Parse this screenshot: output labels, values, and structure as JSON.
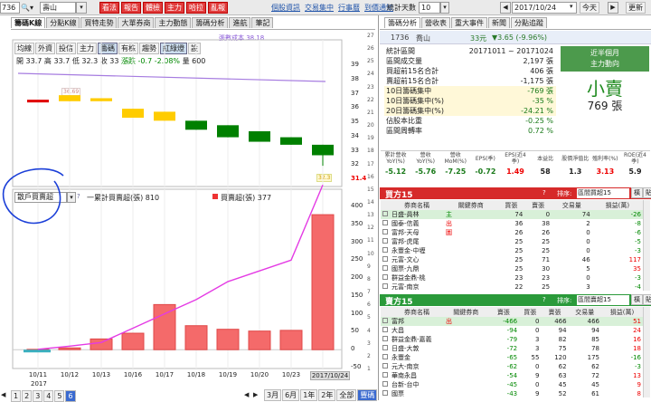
{
  "topbar": {
    "stock_code": "736",
    "stock_name": "壽山",
    "buttons": [
      "看法",
      "報告",
      "體檢",
      "主力",
      "哈拉",
      "亂報"
    ],
    "links": [
      "個股資訊",
      "交易集中",
      "行事曆",
      "到價通知"
    ],
    "right_label": "統計天數",
    "days": "10",
    "date": "2017/10/24",
    "today_btn": "今天",
    "update_btn": "更新"
  },
  "left_tabs": [
    "籌碼K線",
    "分點K線",
    "買特走勢",
    "大單券商",
    "主力動態",
    "籌碼分析",
    "進航",
    "筆記"
  ],
  "chart": {
    "tool_buttons": [
      "均線",
      "外資",
      "投信",
      "主力",
      "籌碼",
      "有株",
      "趨勢",
      "紅綠燈",
      "設"
    ],
    "ohlc": {
      "open_label": "開",
      "open": "33.7",
      "high_label": "高",
      "high": "33.7",
      "low_label": "低",
      "low": "32.3",
      "close_label": "收",
      "close": "33",
      "change_label": "漲跌",
      "change": "-0.7",
      "pct": "-2.08%",
      "vol_label": "量",
      "vol": "600"
    },
    "cost_label": "張數成本 38.18",
    "price_note": "36.69",
    "last_price_tag": "32.3",
    "price_axis": [
      "39",
      "38",
      "37",
      "36",
      "35",
      "34",
      "33",
      "32",
      "31.4"
    ],
    "vol_axis": [
      "27",
      "26",
      "25",
      "24",
      "23",
      "22",
      "21",
      "20",
      "19",
      "18",
      "17",
      "16",
      "15",
      "14",
      "13",
      "12",
      "11",
      "10",
      "9",
      "8",
      "7",
      "6",
      "5",
      "4",
      "3",
      "2",
      "1"
    ],
    "left_axis": [
      "400",
      "350",
      "300",
      "250",
      "200",
      "150",
      "100",
      "50",
      "0",
      "-50"
    ],
    "select_label": "散戶買賣超",
    "legend1": "一累計買賣超(張) 810",
    "legend2": "買賣超(張) 377",
    "dates": [
      "10/11",
      "10/12",
      "10/13",
      "10/16",
      "10/17",
      "10/18",
      "10/19",
      "10/20",
      "10/23",
      "2017/10/24"
    ],
    "year": "2017",
    "bottom_tabs": [
      "1",
      "2",
      "3",
      "4",
      "5",
      "6"
    ],
    "period_buttons": [
      "3月",
      "6月",
      "1年",
      "2年",
      "全部",
      "豐碼"
    ]
  },
  "chart_data": {
    "type": "bar",
    "categories": [
      "10/11",
      "10/12",
      "10/13",
      "10/16",
      "10/17",
      "10/18",
      "10/19",
      "10/20",
      "10/23",
      "10/24"
    ],
    "candles": [
      {
        "open": 36.7,
        "close": 36.7,
        "high": 36.7,
        "low": 36.7
      },
      {
        "open": 37.0,
        "close": 36.6,
        "high": 37.0,
        "low": 36.6
      },
      {
        "open": 36.6,
        "close": 36.8,
        "high": 36.8,
        "low": 36.6
      },
      {
        "open": 36.1,
        "close": 35.5,
        "high": 36.1,
        "low": 35.5
      },
      {
        "open": 35.9,
        "close": 35.3,
        "high": 35.9,
        "low": 35.3
      },
      {
        "open": 35.3,
        "close": 34.7,
        "high": 35.3,
        "low": 34.7
      },
      {
        "open": 35.0,
        "close": 34.2,
        "high": 35.0,
        "low": 34.2
      },
      {
        "open": 34.6,
        "close": 33.9,
        "high": 34.6,
        "low": 33.9
      },
      {
        "open": 34.2,
        "close": 33.7,
        "high": 34.2,
        "low": 33.7
      },
      {
        "open": 33.7,
        "close": 33.0,
        "high": 33.7,
        "low": 32.3
      }
    ],
    "candle_colors": [
      "#e00000",
      "#ffcc00",
      "#ffcc00",
      "#ffcc00",
      "#ffcc00",
      "#008000",
      "#008000",
      "#008000",
      "#008000",
      "#008000"
    ],
    "series": [
      {
        "name": "買賣超(張)",
        "values": [
          1,
          5,
          30,
          46,
          126,
          67,
          57,
          52,
          54,
          377
        ]
      },
      {
        "name": "累計買賣超(張)",
        "values": [
          1,
          10,
          20,
          60,
          100,
          140,
          190,
          220,
          250,
          810
        ]
      }
    ],
    "ylim": [
      -50,
      400
    ]
  },
  "right_tabs": [
    "籌碼分析",
    "營收表",
    "重大事件",
    "新聞",
    "分點追蹤"
  ],
  "summary": {
    "code": "1736",
    "name": "喬山",
    "price": "33元",
    "change": "▼3.65 (-9.96%)",
    "rows": [
      {
        "label": "統計區間",
        "value": "20171011 ~ 20171024"
      },
      {
        "label": "區間成交量",
        "value": "2,197 張"
      },
      {
        "label": "買超前15名合計",
        "value": "406 張"
      },
      {
        "label": "賣超前15名合計",
        "value": "-1,175 張"
      },
      {
        "label": "10日籌碼集中",
        "value": "-769 張"
      },
      {
        "label": "10日籌碼集中(%)",
        "value": "-35 %"
      },
      {
        "label": "20日籌碼集中(%)",
        "value": "-24.21 %"
      },
      {
        "label": "佔股本比重",
        "value": "-0.25 %"
      },
      {
        "label": "區間周轉率",
        "value": "0.72 %"
      }
    ],
    "side_title1": "近半個月",
    "side_title2": "主力動向",
    "verdict": "小賣",
    "verdict_value": "769 張"
  },
  "metrics": {
    "headers": [
      "累計營收YoY(%)",
      "營收YoY(%)",
      "營收MoM(%)",
      "EPS(季)",
      "EPS(近4季)",
      "本益比",
      "股價淨值比",
      "殖利率(%)",
      "ROE(近4季)"
    ],
    "values": [
      "-5.12",
      "-5.76",
      "-7.25",
      "-0.72",
      "1.49",
      "58",
      "1.3",
      "3.13",
      "5.9"
    ]
  },
  "buy15": {
    "title": "買方15",
    "sort_label": "排序:",
    "sort_value": "區間買超15",
    "btn1": "橫",
    "btn2": "貼",
    "headers": [
      "券商名稱",
      "關鍵券商",
      "買張",
      "賣張",
      "交易量",
      "損益(萬)"
    ],
    "rows": [
      {
        "name": "日盛-員林",
        "key": "主",
        "buy": "74",
        "sell": "0",
        "vol": "74",
        "pl": "-26"
      },
      {
        "name": "國泰-信義",
        "key": "出",
        "buy": "36",
        "sell": "38",
        "vol": "2",
        "pl": "-8"
      },
      {
        "name": "富邦-天母",
        "key": "圖",
        "buy": "26",
        "sell": "26",
        "vol": "0",
        "pl": "-6"
      },
      {
        "name": "富邦-虎尾",
        "key": "",
        "buy": "25",
        "sell": "25",
        "vol": "0",
        "pl": "-5"
      },
      {
        "name": "永豐金-中壢",
        "key": "",
        "buy": "25",
        "sell": "25",
        "vol": "0",
        "pl": "-3"
      },
      {
        "name": "元富-文心",
        "key": "",
        "buy": "25",
        "sell": "71",
        "vol": "46",
        "pl": "117"
      },
      {
        "name": "國票-九鼎",
        "key": "",
        "buy": "25",
        "sell": "30",
        "vol": "5",
        "pl": "35"
      },
      {
        "name": "群益金鼎-桃",
        "key": "",
        "buy": "23",
        "sell": "23",
        "vol": "0",
        "pl": "-3"
      },
      {
        "name": "元富-南京",
        "key": "",
        "buy": "22",
        "sell": "25",
        "vol": "3",
        "pl": "-4"
      }
    ]
  },
  "sell15": {
    "title": "賣方15",
    "sort_label": "排序:",
    "sort_value": "區間賣超15",
    "btn1": "橫",
    "btn2": "貼",
    "headers": [
      "券商名稱",
      "關鍵券商",
      "賣張",
      "買張",
      "賣張",
      "交易量",
      "損益(萬)"
    ],
    "rows": [
      {
        "name": "富邦",
        "key": "出",
        "net": "-466",
        "buy": "0",
        "sell": "466",
        "vol": "466",
        "pl": "51"
      },
      {
        "name": "大昌",
        "key": "",
        "net": "-94",
        "buy": "0",
        "sell": "94",
        "vol": "94",
        "pl": "24"
      },
      {
        "name": "群益金鼎-嘉義",
        "key": "",
        "net": "-79",
        "buy": "3",
        "sell": "82",
        "vol": "85",
        "pl": "16"
      },
      {
        "name": "日盛-大敦",
        "key": "",
        "net": "-72",
        "buy": "3",
        "sell": "75",
        "vol": "78",
        "pl": "18"
      },
      {
        "name": "永豐金",
        "key": "",
        "net": "-65",
        "buy": "55",
        "sell": "120",
        "vol": "175",
        "pl": "-16"
      },
      {
        "name": "元大-南京",
        "key": "",
        "net": "-62",
        "buy": "0",
        "sell": "62",
        "vol": "62",
        "pl": "-3"
      },
      {
        "name": "華南永昌",
        "key": "",
        "net": "-54",
        "buy": "9",
        "sell": "63",
        "vol": "72",
        "pl": "13"
      },
      {
        "name": "台新-台中",
        "key": "",
        "net": "-45",
        "buy": "0",
        "sell": "45",
        "vol": "45",
        "pl": "9"
      },
      {
        "name": "國票",
        "key": "",
        "net": "-43",
        "buy": "9",
        "sell": "52",
        "vol": "61",
        "pl": "8"
      }
    ]
  }
}
